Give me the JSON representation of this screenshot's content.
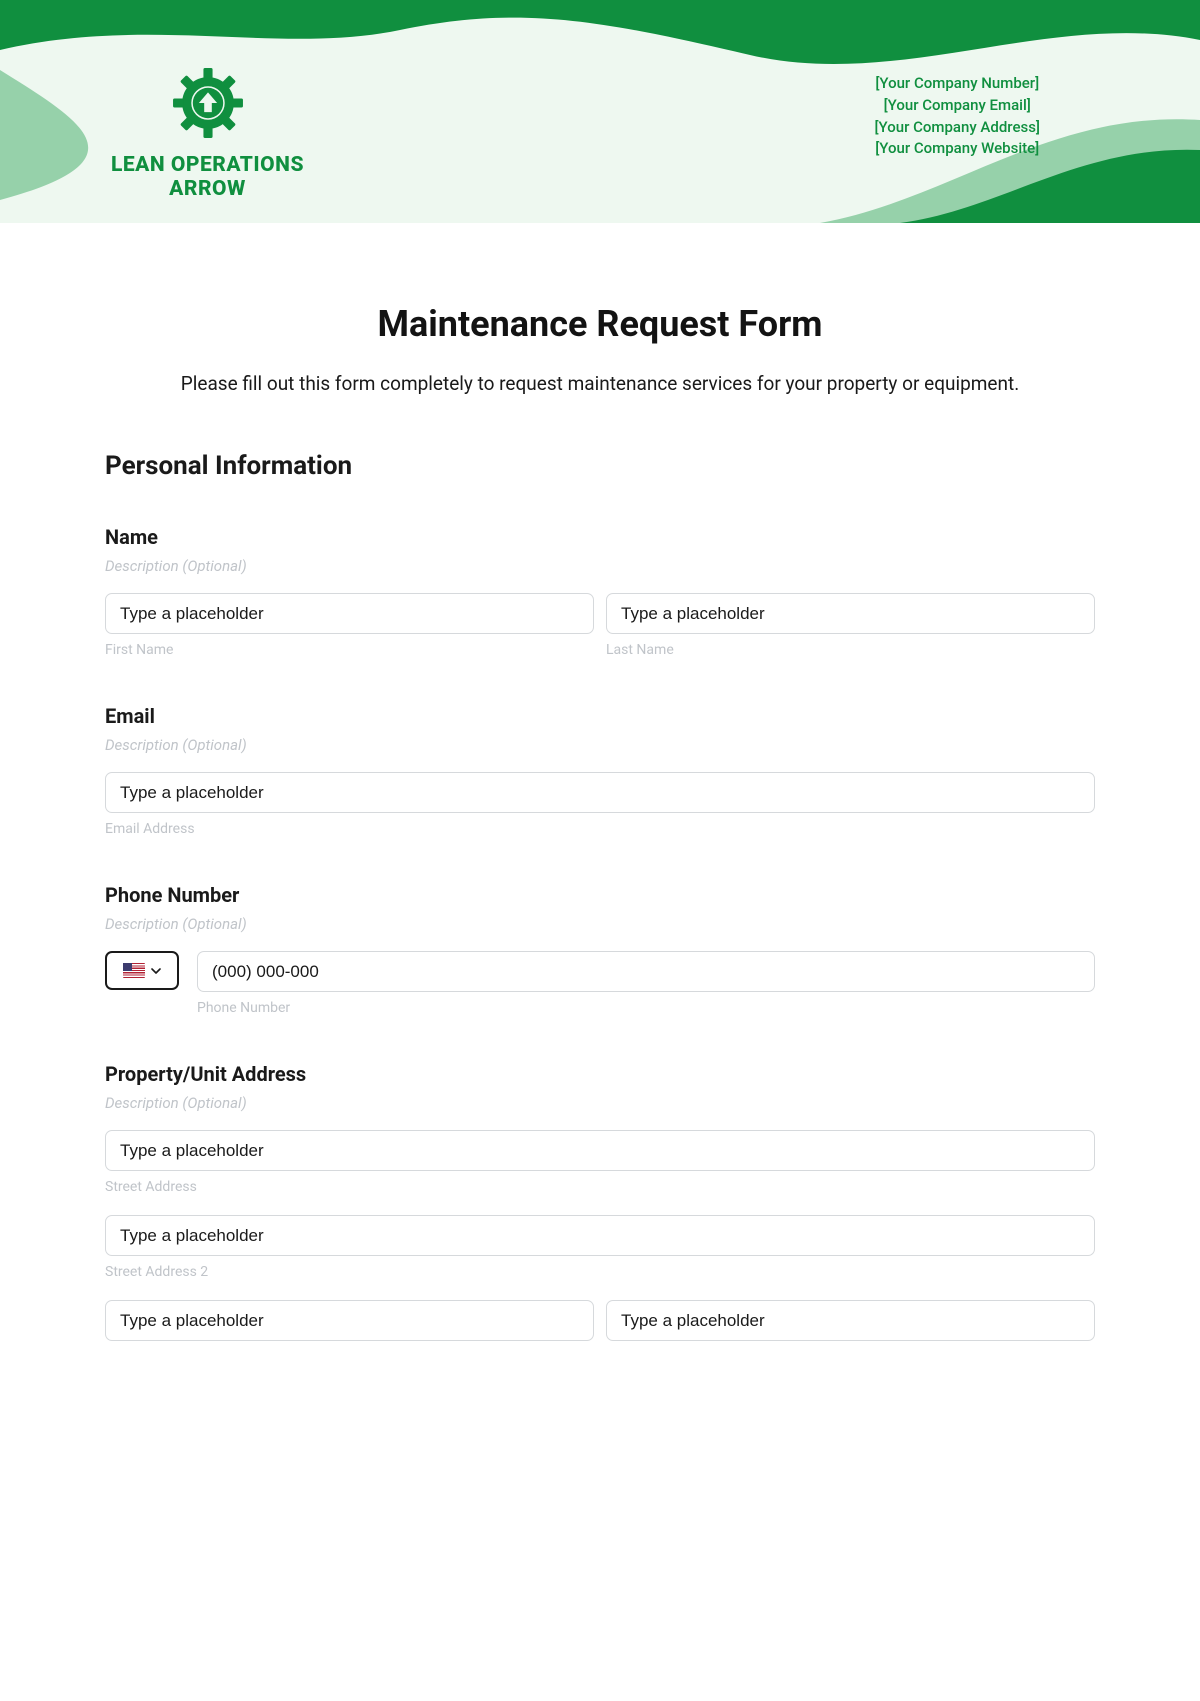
{
  "banner": {
    "company_name": "LEAN OPERATIONS ARROW",
    "info": {
      "number": "[Your Company Number]",
      "email": "[Your Company Email]",
      "address": "[Your Company Address]",
      "website": "[Your Company Website]"
    }
  },
  "form": {
    "title": "Maintenance Request Form",
    "subtitle": "Please fill out this form completely to request maintenance services for your property or equipment.",
    "section_personal": "Personal Information",
    "desc_optional": "Description (Optional)",
    "name": {
      "label": "Name",
      "first_placeholder": "Type a placeholder",
      "first_sub": "First Name",
      "last_placeholder": "Type a placeholder",
      "last_sub": "Last Name"
    },
    "email": {
      "label": "Email",
      "placeholder": "Type a placeholder",
      "sub": "Email Address"
    },
    "phone": {
      "label": "Phone Number",
      "placeholder": "(000) 000-000",
      "sub": "Phone Number"
    },
    "address": {
      "label": "Property/Unit Address",
      "street1_placeholder": "Type a placeholder",
      "street1_sub": "Street Address",
      "street2_placeholder": "Type a placeholder",
      "street2_sub": "Street Address 2",
      "city_placeholder": "Type a placeholder",
      "state_placeholder": "Type a placeholder"
    }
  }
}
